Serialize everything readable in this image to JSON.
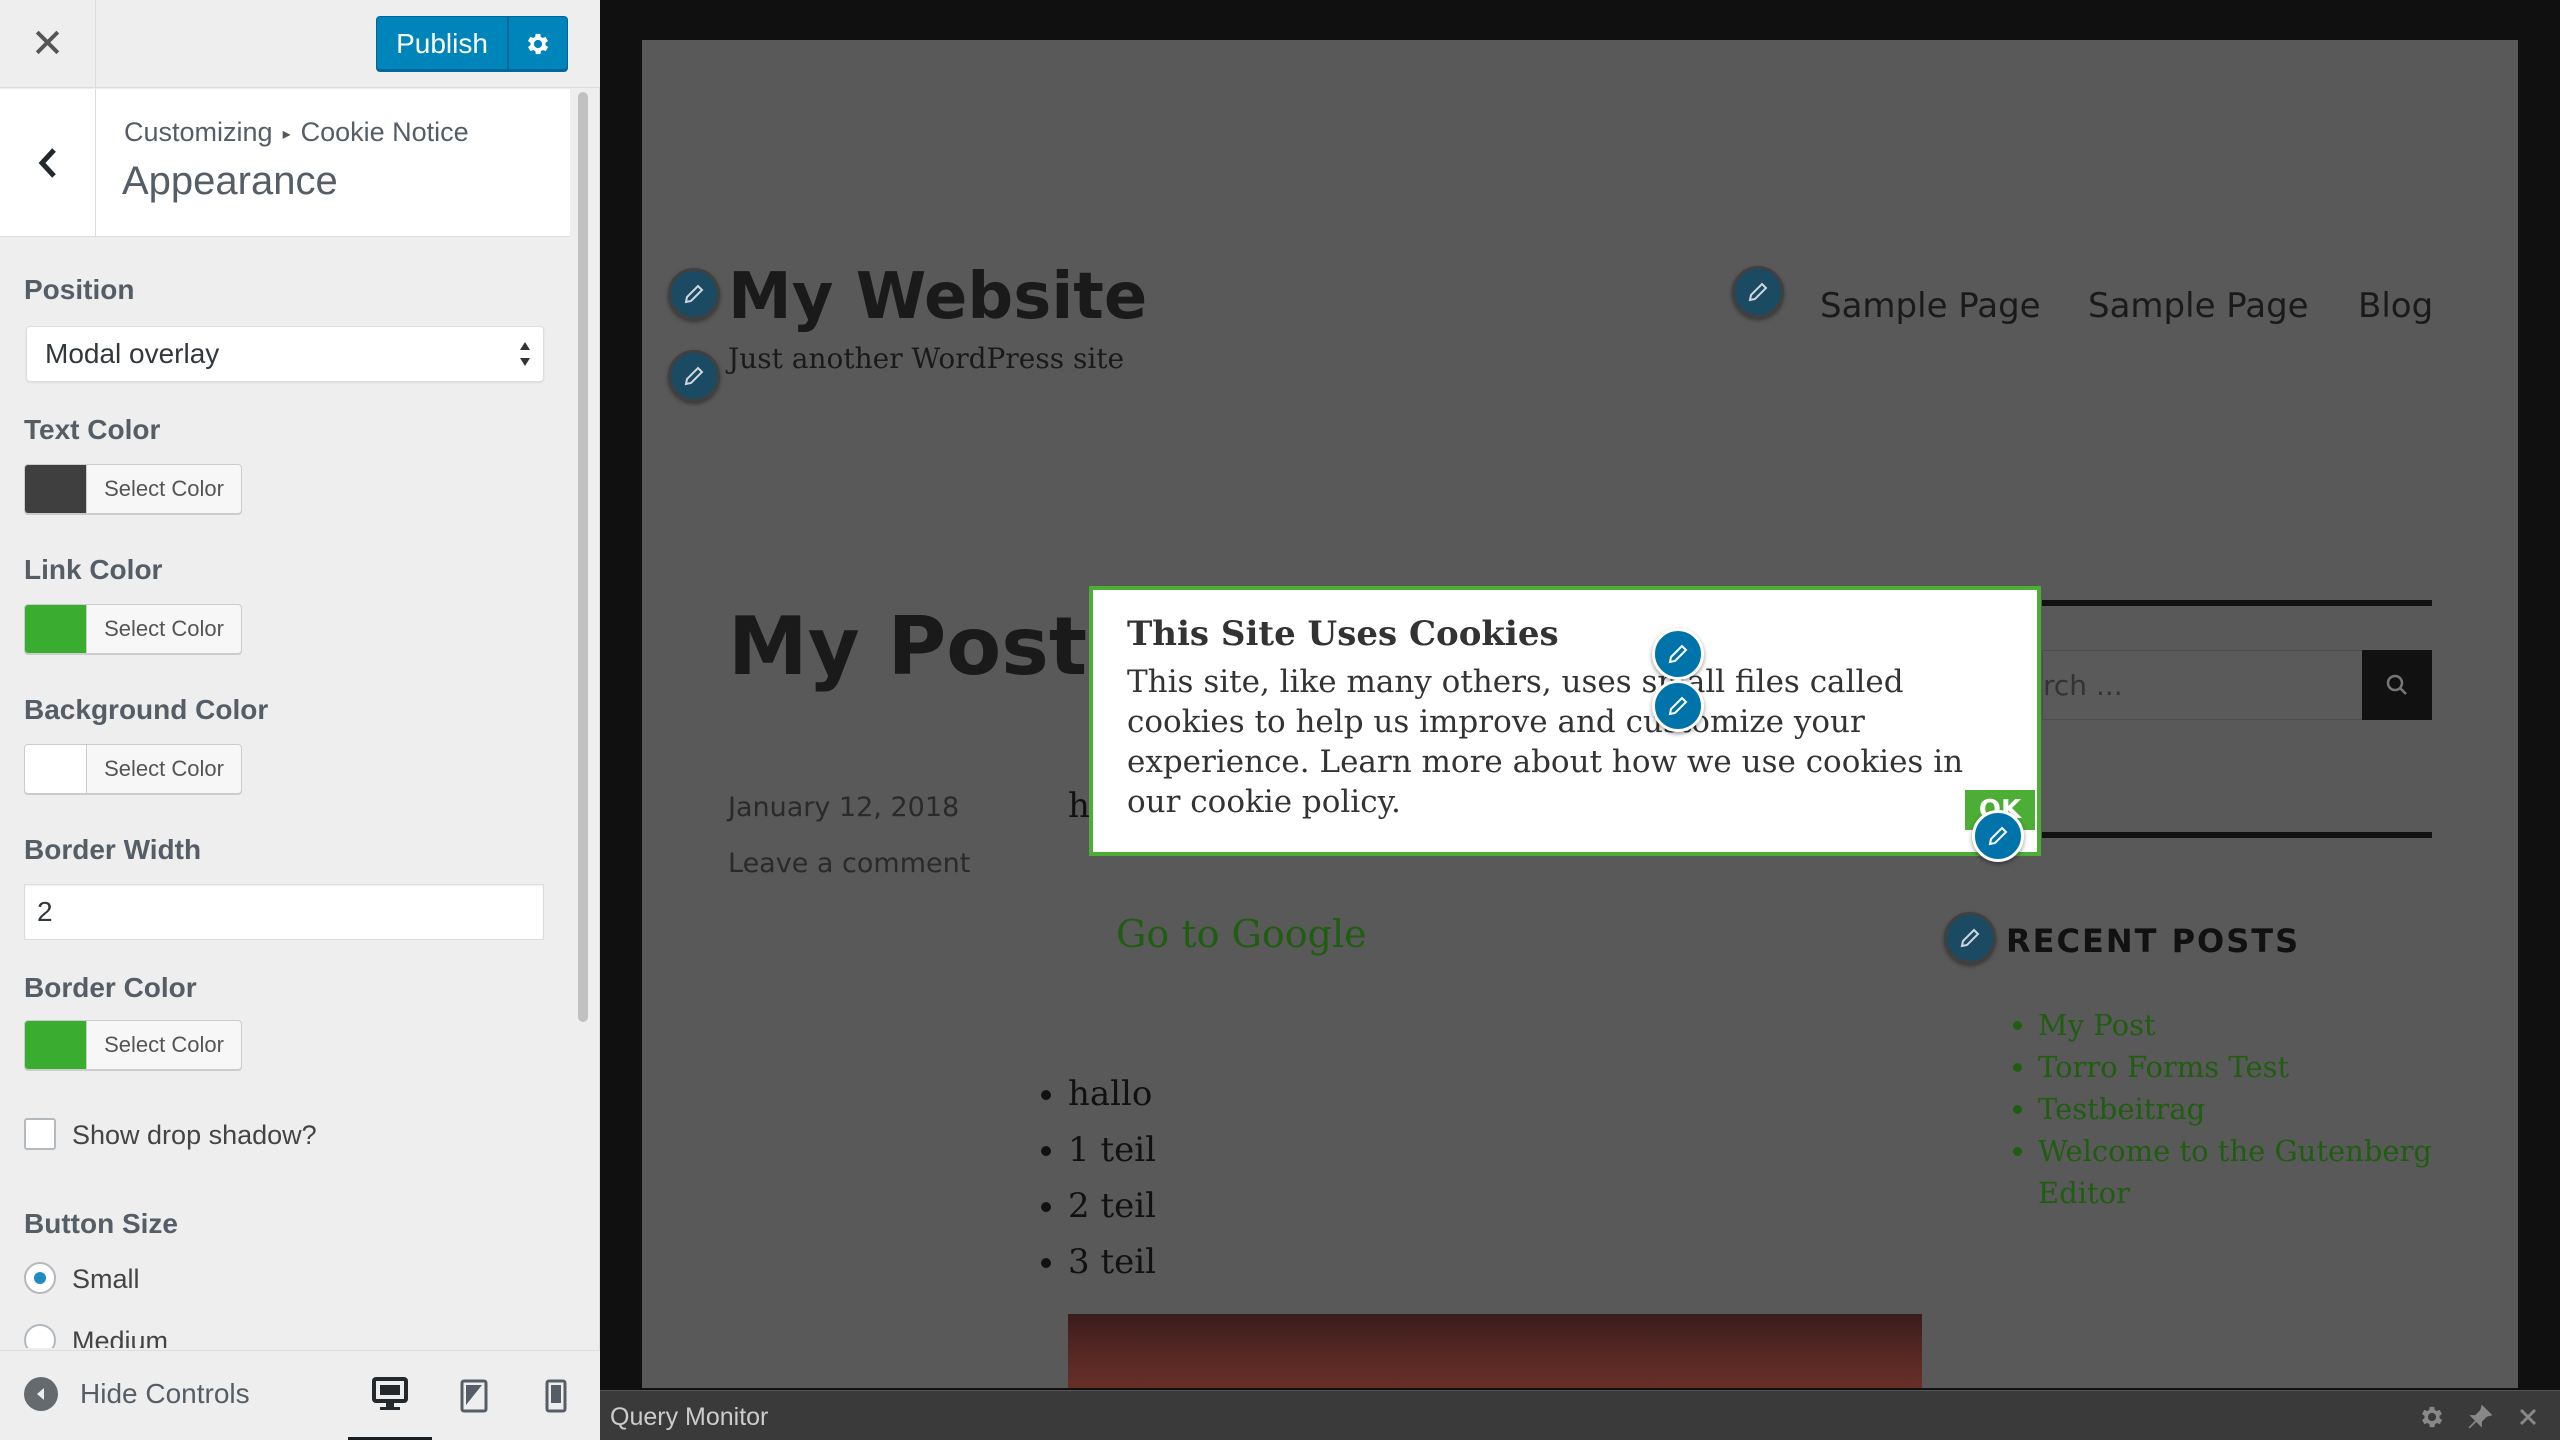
{
  "topbar": {
    "close_label": "✕",
    "publish_label": "Publish"
  },
  "section": {
    "breadcrumb_root": "Customizing",
    "breadcrumb_sep": "▸",
    "breadcrumb_parent": "Cookie Notice",
    "title": "Appearance"
  },
  "controls": {
    "position_label": "Position",
    "position_value": "Modal overlay",
    "text_color_label": "Text Color",
    "text_color": "#3f3f3f",
    "link_color_label": "Link Color",
    "link_color": "#3aac2f",
    "bg_color_label": "Background Color",
    "bg_color": "#ffffff",
    "select_color": "Select Color",
    "border_width_label": "Border Width",
    "border_width_value": "2",
    "border_color_label": "Border Color",
    "border_color": "#3aac2f",
    "shadow_label": "Show drop shadow?",
    "button_size_label": "Button Size",
    "size_small": "Small",
    "size_medium": "Medium"
  },
  "footer": {
    "hide_controls": "Hide Controls"
  },
  "preview": {
    "site_title": "My Website",
    "tagline": "Just another WordPress site",
    "nav": [
      "Sample Page",
      "Sample Page",
      "Blog"
    ],
    "post_title": "My Post",
    "post_date": "January 12, 2018",
    "leave_comment": "Leave a comment",
    "partial_h": "h",
    "go_google": "Go to Google",
    "bullets": [
      "hallo",
      "1 teil",
      "2 teil",
      "3 teil"
    ],
    "search_placeholder": "rch ...",
    "recent_posts_title": "RECENT POSTS",
    "recent_posts": [
      "My Post",
      "Torro Forms Test",
      "Testbeitrag",
      "Welcome to the Gutenberg Editor"
    ]
  },
  "cookie": {
    "title": "This Site Uses Cookies",
    "text": "This site, like many others, uses small files called cookies to help us improve and customize your experience. Learn more about how we use cookies in our cookie policy.",
    "ok_label": "OK",
    "border_color": "#4cae35"
  },
  "query_monitor": {
    "label": "Query Monitor"
  }
}
